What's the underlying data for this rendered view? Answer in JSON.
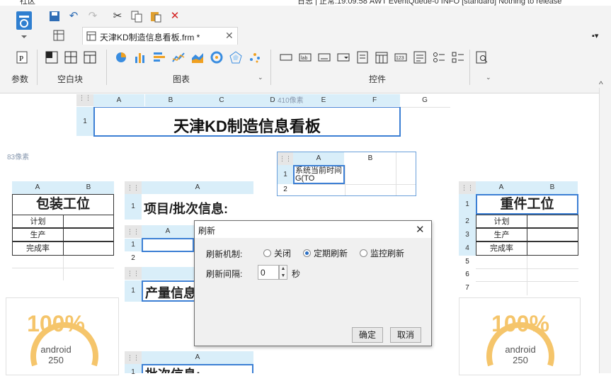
{
  "topbar": {
    "left_text": "社区",
    "right_text": "日志  |  正常:19:09:58 AWT EventQueue-0 INFO [standard] Nothing to release"
  },
  "tab": {
    "title": "天津KD制造信息看板.frm *"
  },
  "ribbon": {
    "groups": {
      "params": "参数",
      "blank": "空白块",
      "chart": "图表",
      "widget": "控件"
    }
  },
  "canvas": {
    "width_hint": "410像素",
    "height_hint": "83像素",
    "col_letters": {
      "a": "A",
      "b": "B",
      "c": "C",
      "d": "D",
      "e": "E",
      "f": "F",
      "g": "G"
    },
    "title_row": "1",
    "title": "天津KD制造信息看板",
    "time_block": {
      "col_a": "A",
      "col_b": "B",
      "row1": "1",
      "row2": "2",
      "cell": "系统当前时间 G(TO"
    },
    "pack": {
      "col_a": "A",
      "col_b": "B",
      "title": "包装工位",
      "rows": [
        "计划",
        "生产",
        "完成率"
      ]
    },
    "project": {
      "col_a": "A",
      "row": "1",
      "label": "项目/批次信息:"
    },
    "inner": {
      "col_a": "A",
      "rows": [
        "1",
        "2"
      ]
    },
    "yield": {
      "row": "1",
      "label": "产量信息"
    },
    "batch": {
      "col_a": "A",
      "row": "1",
      "label": "批次信息:"
    },
    "heavy": {
      "col_a": "A",
      "col_b": "B",
      "title": "重件工位",
      "rows": [
        "计划",
        "生产",
        "完成率"
      ],
      "row_nums": [
        "1",
        "2",
        "3",
        "4",
        "5",
        "6",
        "7"
      ]
    },
    "gauge_left": {
      "pct": "100%",
      "name": "android",
      "value": "250"
    },
    "gauge_right": {
      "pct": "100%",
      "name": "android",
      "value": "250"
    }
  },
  "dialog": {
    "title": "刷新",
    "mechanism_label": "刷新机制:",
    "options": [
      "关闭",
      "定期刷新",
      "监控刷新"
    ],
    "selected": "定期刷新",
    "interval_label": "刷新间隔:",
    "interval_value": "0",
    "unit": "秒",
    "ok": "确定",
    "cancel": "取消"
  }
}
